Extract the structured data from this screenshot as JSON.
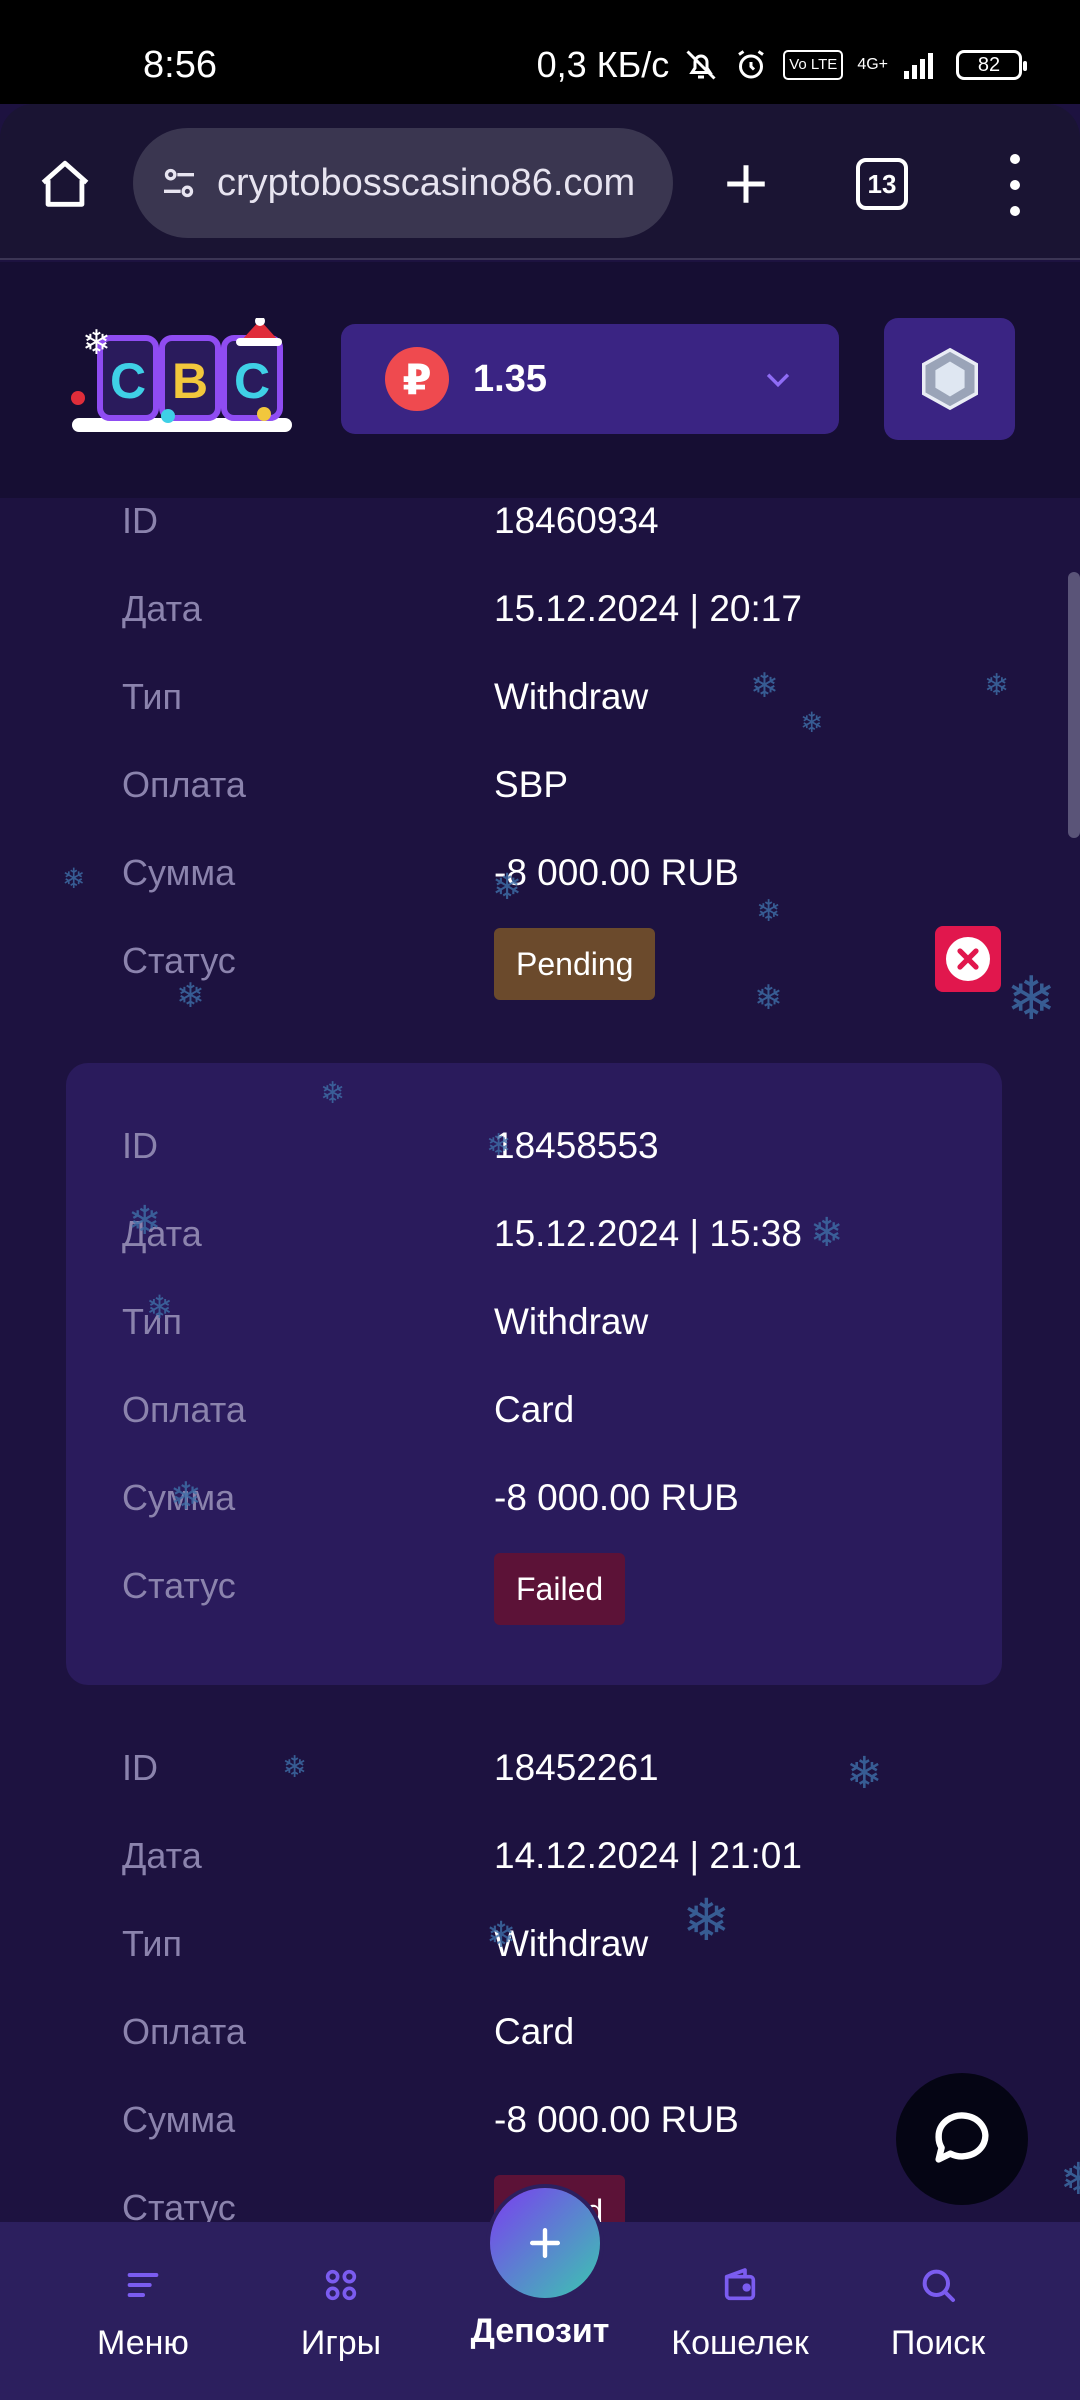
{
  "status_bar": {
    "time": "8:56",
    "speed": "0,3 КБ/с",
    "volte": "Vo LTE",
    "network": "4G+",
    "battery": "82"
  },
  "browser": {
    "url": "cryptobosscasino86.com",
    "tab_count": "13"
  },
  "header": {
    "currency_symbol": "₽",
    "balance": "1.35"
  },
  "transactions": [
    {
      "labels": {
        "id": "ID",
        "date": "Дата",
        "type": "Тип",
        "payment": "Оплата",
        "amount": "Сумма",
        "status": "Статус"
      },
      "id": "18460934",
      "date": "15.12.2024 | 20:17",
      "type": "Withdraw",
      "payment": "SBP",
      "amount": "-8 000.00 RUB",
      "status": "Pending"
    },
    {
      "labels": {
        "id": "ID",
        "date": "Дата",
        "type": "Тип",
        "payment": "Оплата",
        "amount": "Сумма",
        "status": "Статус"
      },
      "id": "18458553",
      "date": "15.12.2024 | 15:38",
      "type": "Withdraw",
      "payment": "Card",
      "amount": "-8 000.00 RUB",
      "status": "Failed"
    },
    {
      "labels": {
        "id": "ID",
        "date": "Дата",
        "type": "Тип",
        "payment": "Оплата",
        "amount": "Сумма",
        "status": "Статус"
      },
      "id": "18452261",
      "date": "14.12.2024 | 21:01",
      "type": "Withdraw",
      "payment": "Card",
      "amount": "-8 000.00 RUB",
      "status": "Failed"
    }
  ],
  "bottom_nav": {
    "menu": "Меню",
    "games": "Игры",
    "deposit": "Депозит",
    "wallet": "Кошелек",
    "search": "Поиск"
  },
  "colors": {
    "accent": "#7b5cf0",
    "pending": "#6b4a2c",
    "failed": "#5c1237",
    "cancel": "#e1174d"
  }
}
